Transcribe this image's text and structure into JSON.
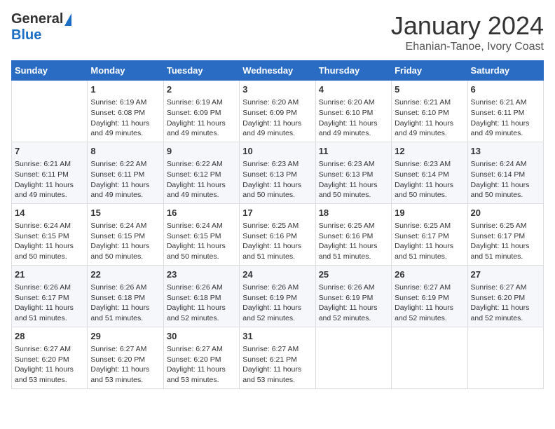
{
  "header": {
    "logo_general": "General",
    "logo_blue": "Blue",
    "month_title": "January 2024",
    "subtitle": "Ehanian-Tanoe, Ivory Coast"
  },
  "days_of_week": [
    "Sunday",
    "Monday",
    "Tuesday",
    "Wednesday",
    "Thursday",
    "Friday",
    "Saturday"
  ],
  "weeks": [
    [
      {
        "day": "",
        "sunrise": "",
        "sunset": "",
        "daylight": "",
        "empty": true
      },
      {
        "day": "1",
        "sunrise": "Sunrise: 6:19 AM",
        "sunset": "Sunset: 6:08 PM",
        "daylight": "Daylight: 11 hours and 49 minutes."
      },
      {
        "day": "2",
        "sunrise": "Sunrise: 6:19 AM",
        "sunset": "Sunset: 6:09 PM",
        "daylight": "Daylight: 11 hours and 49 minutes."
      },
      {
        "day": "3",
        "sunrise": "Sunrise: 6:20 AM",
        "sunset": "Sunset: 6:09 PM",
        "daylight": "Daylight: 11 hours and 49 minutes."
      },
      {
        "day": "4",
        "sunrise": "Sunrise: 6:20 AM",
        "sunset": "Sunset: 6:10 PM",
        "daylight": "Daylight: 11 hours and 49 minutes."
      },
      {
        "day": "5",
        "sunrise": "Sunrise: 6:21 AM",
        "sunset": "Sunset: 6:10 PM",
        "daylight": "Daylight: 11 hours and 49 minutes."
      },
      {
        "day": "6",
        "sunrise": "Sunrise: 6:21 AM",
        "sunset": "Sunset: 6:11 PM",
        "daylight": "Daylight: 11 hours and 49 minutes."
      }
    ],
    [
      {
        "day": "7",
        "sunrise": "Sunrise: 6:21 AM",
        "sunset": "Sunset: 6:11 PM",
        "daylight": "Daylight: 11 hours and 49 minutes."
      },
      {
        "day": "8",
        "sunrise": "Sunrise: 6:22 AM",
        "sunset": "Sunset: 6:11 PM",
        "daylight": "Daylight: 11 hours and 49 minutes."
      },
      {
        "day": "9",
        "sunrise": "Sunrise: 6:22 AM",
        "sunset": "Sunset: 6:12 PM",
        "daylight": "Daylight: 11 hours and 49 minutes."
      },
      {
        "day": "10",
        "sunrise": "Sunrise: 6:23 AM",
        "sunset": "Sunset: 6:13 PM",
        "daylight": "Daylight: 11 hours and 50 minutes."
      },
      {
        "day": "11",
        "sunrise": "Sunrise: 6:23 AM",
        "sunset": "Sunset: 6:13 PM",
        "daylight": "Daylight: 11 hours and 50 minutes."
      },
      {
        "day": "12",
        "sunrise": "Sunrise: 6:23 AM",
        "sunset": "Sunset: 6:14 PM",
        "daylight": "Daylight: 11 hours and 50 minutes."
      },
      {
        "day": "13",
        "sunrise": "Sunrise: 6:24 AM",
        "sunset": "Sunset: 6:14 PM",
        "daylight": "Daylight: 11 hours and 50 minutes."
      }
    ],
    [
      {
        "day": "14",
        "sunrise": "Sunrise: 6:24 AM",
        "sunset": "Sunset: 6:15 PM",
        "daylight": "Daylight: 11 hours and 50 minutes."
      },
      {
        "day": "15",
        "sunrise": "Sunrise: 6:24 AM",
        "sunset": "Sunset: 6:15 PM",
        "daylight": "Daylight: 11 hours and 50 minutes."
      },
      {
        "day": "16",
        "sunrise": "Sunrise: 6:24 AM",
        "sunset": "Sunset: 6:15 PM",
        "daylight": "Daylight: 11 hours and 50 minutes."
      },
      {
        "day": "17",
        "sunrise": "Sunrise: 6:25 AM",
        "sunset": "Sunset: 6:16 PM",
        "daylight": "Daylight: 11 hours and 51 minutes."
      },
      {
        "day": "18",
        "sunrise": "Sunrise: 6:25 AM",
        "sunset": "Sunset: 6:16 PM",
        "daylight": "Daylight: 11 hours and 51 minutes."
      },
      {
        "day": "19",
        "sunrise": "Sunrise: 6:25 AM",
        "sunset": "Sunset: 6:17 PM",
        "daylight": "Daylight: 11 hours and 51 minutes."
      },
      {
        "day": "20",
        "sunrise": "Sunrise: 6:25 AM",
        "sunset": "Sunset: 6:17 PM",
        "daylight": "Daylight: 11 hours and 51 minutes."
      }
    ],
    [
      {
        "day": "21",
        "sunrise": "Sunrise: 6:26 AM",
        "sunset": "Sunset: 6:17 PM",
        "daylight": "Daylight: 11 hours and 51 minutes."
      },
      {
        "day": "22",
        "sunrise": "Sunrise: 6:26 AM",
        "sunset": "Sunset: 6:18 PM",
        "daylight": "Daylight: 11 hours and 51 minutes."
      },
      {
        "day": "23",
        "sunrise": "Sunrise: 6:26 AM",
        "sunset": "Sunset: 6:18 PM",
        "daylight": "Daylight: 11 hours and 52 minutes."
      },
      {
        "day": "24",
        "sunrise": "Sunrise: 6:26 AM",
        "sunset": "Sunset: 6:19 PM",
        "daylight": "Daylight: 11 hours and 52 minutes."
      },
      {
        "day": "25",
        "sunrise": "Sunrise: 6:26 AM",
        "sunset": "Sunset: 6:19 PM",
        "daylight": "Daylight: 11 hours and 52 minutes."
      },
      {
        "day": "26",
        "sunrise": "Sunrise: 6:27 AM",
        "sunset": "Sunset: 6:19 PM",
        "daylight": "Daylight: 11 hours and 52 minutes."
      },
      {
        "day": "27",
        "sunrise": "Sunrise: 6:27 AM",
        "sunset": "Sunset: 6:20 PM",
        "daylight": "Daylight: 11 hours and 52 minutes."
      }
    ],
    [
      {
        "day": "28",
        "sunrise": "Sunrise: 6:27 AM",
        "sunset": "Sunset: 6:20 PM",
        "daylight": "Daylight: 11 hours and 53 minutes."
      },
      {
        "day": "29",
        "sunrise": "Sunrise: 6:27 AM",
        "sunset": "Sunset: 6:20 PM",
        "daylight": "Daylight: 11 hours and 53 minutes."
      },
      {
        "day": "30",
        "sunrise": "Sunrise: 6:27 AM",
        "sunset": "Sunset: 6:20 PM",
        "daylight": "Daylight: 11 hours and 53 minutes."
      },
      {
        "day": "31",
        "sunrise": "Sunrise: 6:27 AM",
        "sunset": "Sunset: 6:21 PM",
        "daylight": "Daylight: 11 hours and 53 minutes."
      },
      {
        "day": "",
        "sunrise": "",
        "sunset": "",
        "daylight": "",
        "empty": true
      },
      {
        "day": "",
        "sunrise": "",
        "sunset": "",
        "daylight": "",
        "empty": true
      },
      {
        "day": "",
        "sunrise": "",
        "sunset": "",
        "daylight": "",
        "empty": true
      }
    ]
  ]
}
